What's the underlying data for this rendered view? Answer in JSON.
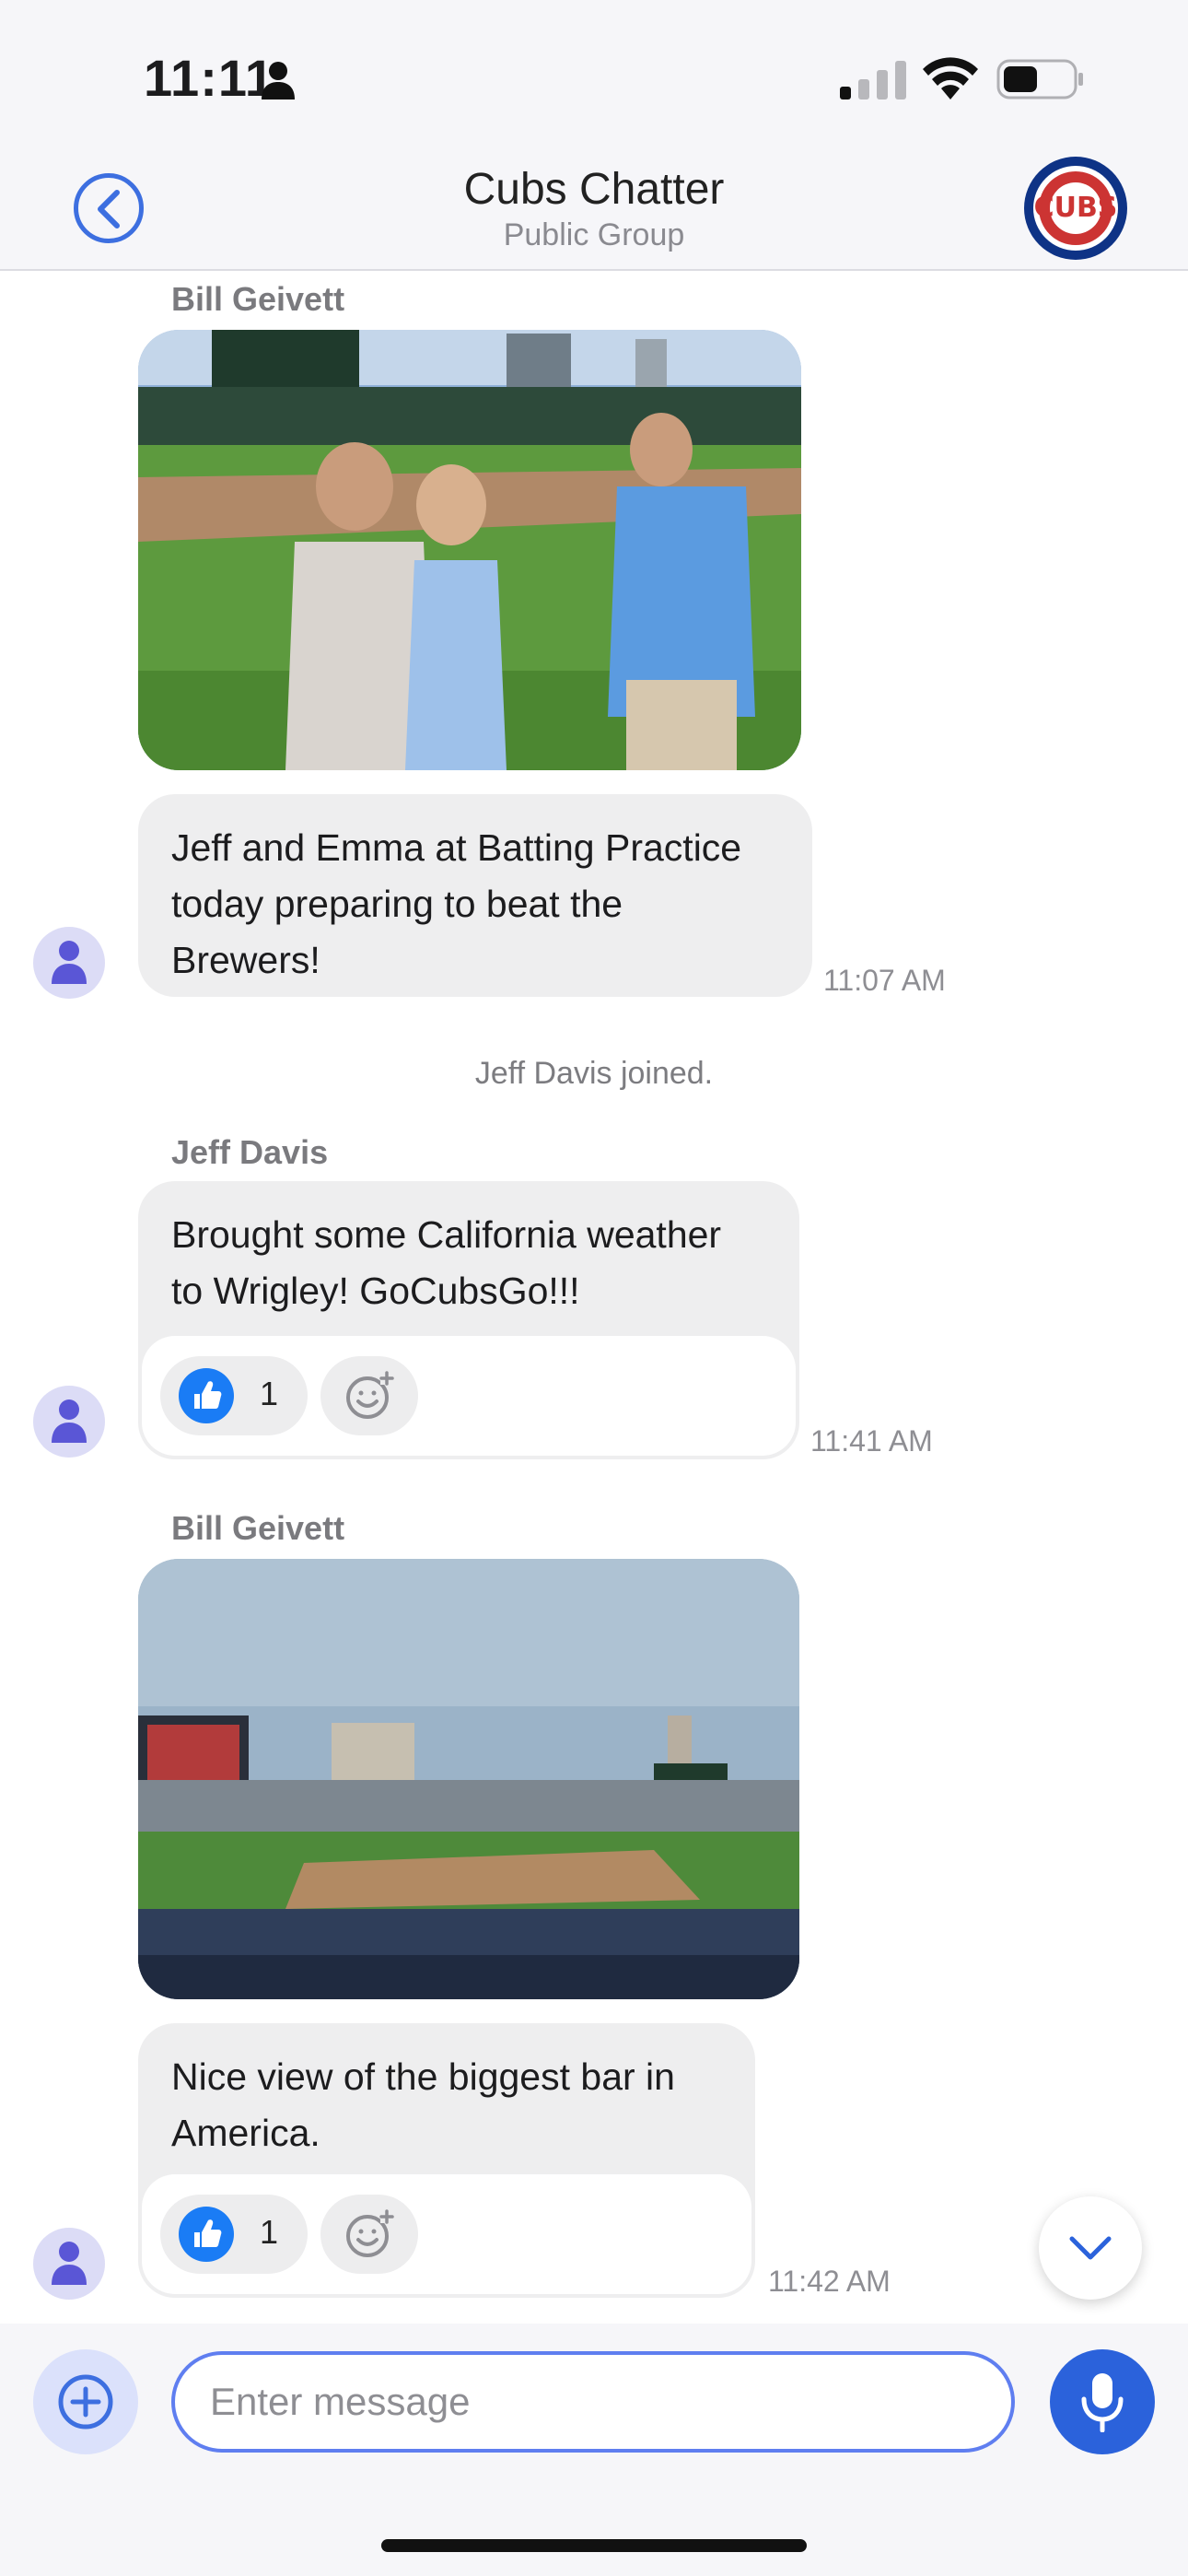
{
  "status_bar": {
    "time": "11:11"
  },
  "header": {
    "title": "Cubs Chatter",
    "subtitle": "Public Group",
    "logo_text": "CUBS"
  },
  "messages": [
    {
      "sender": "Bill Geivett",
      "text": "Jeff and Emma at Batting Practice\ntoday preparing to beat the\nBrewers!",
      "time": "11:07 AM"
    },
    {
      "system": "Jeff Davis joined."
    },
    {
      "sender": "Jeff Davis",
      "text": "Brought some California weather\nto Wrigley! GoCubsGo!!!",
      "time": "11:41 AM",
      "reaction_count": "1"
    },
    {
      "sender": "Bill Geivett",
      "text": "Nice view of the biggest bar in\nAmerica.",
      "time": "11:42 AM",
      "reaction_count": "1"
    }
  ],
  "composer": {
    "placeholder": "Enter message"
  },
  "icons": {
    "back": "chevron-left-circle-icon",
    "reaction": "thumbs-up-icon",
    "add_reaction": "smiley-plus-icon",
    "avatar": "person-icon",
    "attach": "plus-circle-icon",
    "mic": "microphone-icon",
    "scroll": "chevron-down-icon"
  },
  "colors": {
    "accent": "#2b62db",
    "cubs_blue": "#0e3386",
    "cubs_red": "#cc3433",
    "bubble": "#eeeeef"
  }
}
